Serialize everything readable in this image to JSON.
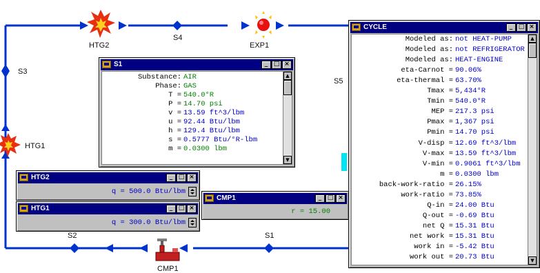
{
  "diagram": {
    "nodes": {
      "htg2": "HTG2",
      "exp1": "EXP1",
      "htg1": "HTG1",
      "cmp1": "CMP1"
    },
    "streams": {
      "s1": "S1",
      "s2": "S2",
      "s3": "S3",
      "s4": "S4",
      "s5": "S5"
    }
  },
  "cycle_window": {
    "title": "CYCLE",
    "rows": [
      {
        "label": "Modeled as:",
        "value": "not HEAT-PUMP"
      },
      {
        "label": "Modeled as:",
        "value": "not REFRIGERATOR"
      },
      {
        "label": "Modeled as:",
        "value": "HEAT-ENGINE"
      },
      {
        "label": "eta-Carnot =",
        "value": "90.06%"
      },
      {
        "label": "eta-thermal =",
        "value": "63.70%"
      },
      {
        "label": "Tmax =",
        "value": "5,434°R"
      },
      {
        "label": "Tmin =",
        "value": "540.0°R"
      },
      {
        "label": "MEP =",
        "value": "217.3 psi"
      },
      {
        "label": "Pmax =",
        "value": "1,367 psi"
      },
      {
        "label": "Pmin =",
        "value": "14.70 psi"
      },
      {
        "label": "V-disp =",
        "value": "12.69 ft^3/lbm"
      },
      {
        "label": "V-max =",
        "value": "13.59 ft^3/lbm"
      },
      {
        "label": "V-min =",
        "value": "0.9061 ft^3/lbm"
      },
      {
        "label": "m =",
        "value": "0.0300 lbm"
      },
      {
        "label": "back-work-ratio =",
        "value": "26.15%"
      },
      {
        "label": "work-ratio =",
        "value": "73.85%"
      },
      {
        "label": "Q-in =",
        "value": "24.00 Btu"
      },
      {
        "label": "Q-out =",
        "value": "-0.69 Btu"
      },
      {
        "label": "net Q =",
        "value": "15.31 Btu"
      },
      {
        "label": "net work =",
        "value": "15.31 Btu"
      },
      {
        "label": "work in =",
        "value": "-5.42 Btu"
      },
      {
        "label": "work out =",
        "value": "20.73 Btu"
      }
    ]
  },
  "s1_window": {
    "title": "S1",
    "rows": [
      {
        "label": "Substance:",
        "value": "AIR",
        "color": "green"
      },
      {
        "label": "Phase:",
        "value": "GAS",
        "color": "green"
      },
      {
        "label": "T =",
        "value": "540.0°R",
        "color": "green"
      },
      {
        "label": "P =",
        "value": "14.70 psi",
        "color": "green"
      },
      {
        "label": "v =",
        "value": "13.59 ft^3/lbm",
        "color": "blue"
      },
      {
        "label": "u =",
        "value": "92.44 Btu/lbm",
        "color": "blue"
      },
      {
        "label": "h =",
        "value": "129.4 Btu/lbm",
        "color": "blue"
      },
      {
        "label": "s =",
        "value": "0.5777 Btu/°R-lbm",
        "color": "blue"
      },
      {
        "label": "m =",
        "value": "0.0300 lbm",
        "color": "green"
      }
    ]
  },
  "htg2_window": {
    "title": "HTG2",
    "field": "q = 500.0 Btu/lbm"
  },
  "htg1_window": {
    "title": "HTG1",
    "field": "q = 300.0 Btu/lbm"
  },
  "cmp1_window": {
    "title": "CMP1",
    "field": "r = 15.00"
  },
  "colors": {
    "flow_line": "#0033cc",
    "titlebar": "#000080",
    "value_blue": "#0000c8",
    "value_green": "#008000",
    "heater_red": "#e83010"
  }
}
